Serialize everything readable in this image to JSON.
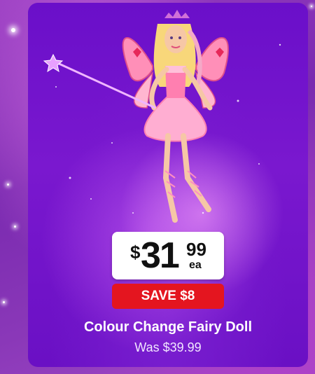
{
  "promo": {
    "price_symbol": "$",
    "price_dollars": "31",
    "price_cents": "99",
    "price_unit": "ea",
    "save_label": "SAVE $8",
    "product_name": "Colour Change Fairy Doll",
    "was_price": "Was $39.99"
  },
  "colors": {
    "save_badge": "#e4151f",
    "card_background": "#6a0fc9",
    "page_background": "#9a3fc2"
  },
  "icons": [
    "sparkle-icon",
    "magic-wand-icon"
  ]
}
